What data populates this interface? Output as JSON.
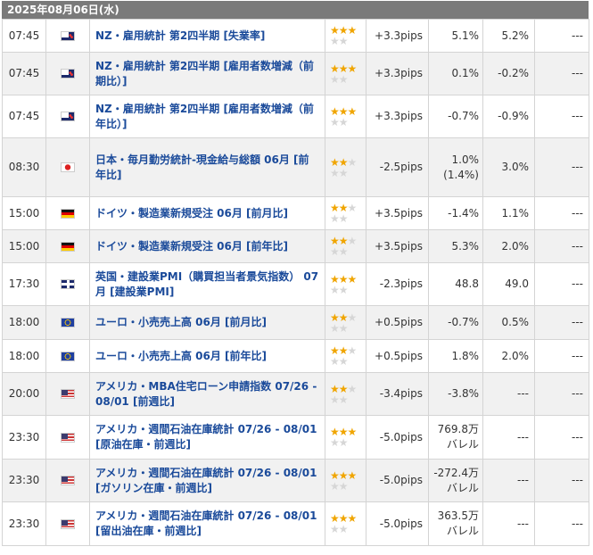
{
  "date_header": "2025年08月06日(水)",
  "rows": [
    {
      "time": "07:45",
      "flag": "nz-flag-icon",
      "name": "NZ・雇用統計 第2四半期 [失業率]",
      "stars": 3,
      "pips": "+3.3pips",
      "result": "5.1%",
      "forecast": "5.2%",
      "previous": "---",
      "height": 37
    },
    {
      "time": "07:45",
      "flag": "nz-flag-icon",
      "name": "NZ・雇用統計 第2四半期 [雇用者数増減（前期比）]",
      "stars": 3,
      "pips": "+3.3pips",
      "result": "0.1%",
      "forecast": "-0.2%",
      "previous": "---",
      "height": 48
    },
    {
      "time": "07:45",
      "flag": "nz-flag-icon",
      "name": "NZ・雇用統計 第2四半期 [雇用者数増減（前年比）]",
      "stars": 3,
      "pips": "+3.3pips",
      "result": "-0.7%",
      "forecast": "-0.9%",
      "previous": "---",
      "height": 48
    },
    {
      "time": "08:30",
      "flag": "japan-flag-icon",
      "name": "日本・毎月勤労統計-現金給与総額 06月 [前年比]",
      "stars": 2,
      "pips": "-2.5pips",
      "result": "1.0%(1.4%)",
      "forecast": "3.0%",
      "previous": "---",
      "height": 66
    },
    {
      "time": "15:00",
      "flag": "germany-flag-icon",
      "name": "ドイツ・製造業新規受注 06月 [前月比]",
      "stars": 2,
      "pips": "+3.5pips",
      "result": "-1.4%",
      "forecast": "1.1%",
      "previous": "---",
      "height": 37
    },
    {
      "time": "15:00",
      "flag": "germany-flag-icon",
      "name": "ドイツ・製造業新規受注 06月 [前年比]",
      "stars": 2,
      "pips": "+3.5pips",
      "result": "5.3%",
      "forecast": "2.0%",
      "previous": "---",
      "height": 37
    },
    {
      "time": "17:30",
      "flag": "uk-flag-icon",
      "name": "英国・建設業PMI（購買担当者景気指数） 07月 [建設業PMI]",
      "stars": 3,
      "pips": "-2.3pips",
      "result": "48.8",
      "forecast": "49.0",
      "previous": "---",
      "height": 48
    },
    {
      "time": "18:00",
      "flag": "eu-flag-icon",
      "name": "ユーロ・小売売上高 06月 [前月比]",
      "stars": 2,
      "pips": "+0.5pips",
      "result": "-0.7%",
      "forecast": "0.5%",
      "previous": "---",
      "height": 38
    },
    {
      "time": "18:00",
      "flag": "eu-flag-icon",
      "name": "ユーロ・小売売上高 06月 [前年比]",
      "stars": 2,
      "pips": "+0.5pips",
      "result": "1.8%",
      "forecast": "2.0%",
      "previous": "---",
      "height": 37
    },
    {
      "time": "20:00",
      "flag": "us-flag-icon",
      "name": "アメリカ・MBA住宅ローン申請指数 07/26 - 08/01 [前週比]",
      "stars": 2,
      "pips": "-3.4pips",
      "result": "-3.8%",
      "forecast": "---",
      "previous": "---",
      "height": 48
    },
    {
      "time": "23:30",
      "flag": "us-flag-icon",
      "name": "アメリカ・週間石油在庫統計 07/26 - 08/01 [原油在庫・前週比]",
      "stars": 3,
      "pips": "-5.0pips",
      "result": "769.8万バレル",
      "forecast": "---",
      "previous": "---",
      "height": 49
    },
    {
      "time": "23:30",
      "flag": "us-flag-icon",
      "name": "アメリカ・週間石油在庫統計 07/26 - 08/01 [ガソリン在庫・前週比]",
      "stars": 3,
      "pips": "-5.0pips",
      "result": "-272.4万バレル",
      "forecast": "---",
      "previous": "---",
      "height": 48
    },
    {
      "time": "23:30",
      "flag": "us-flag-icon",
      "name": "アメリカ・週間石油在庫統計 07/26 - 08/01 [留出油在庫・前週比]",
      "stars": 3,
      "pips": "-5.0pips",
      "result": "363.5万バレル",
      "forecast": "---",
      "previous": "---",
      "height": 49
    }
  ]
}
